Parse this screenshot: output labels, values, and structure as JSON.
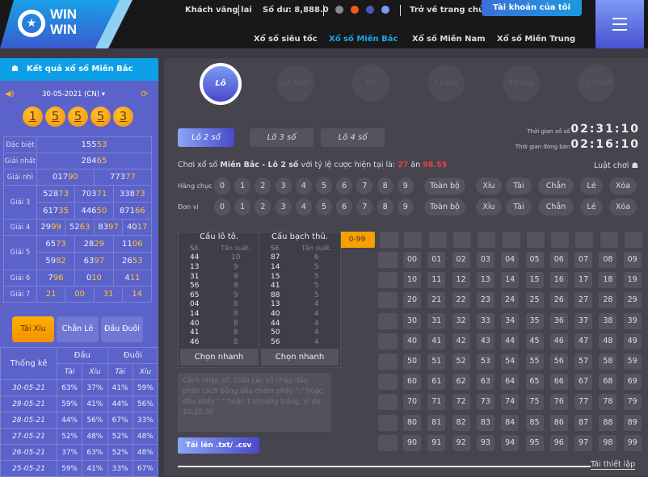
{
  "brand": {
    "logo_text": "WIN WIN"
  },
  "header": {
    "user": "Khách vãng lai",
    "balance": "Số dư: 8,888.0",
    "home": "Trở về trang chủ",
    "account": "Tài khoản của tôi",
    "nav": [
      "Xổ số siêu tốc",
      "Xổ số Miền Bắc",
      "Xổ số Miền Nam",
      "Xổ số Miền Trung"
    ],
    "active_nav": 1,
    "dot_colors": [
      "#888888",
      "#f05a1a",
      "#4a57c0",
      "#7b9af5"
    ]
  },
  "results": {
    "title": "Kết quả xổ số Miền Bắc",
    "date": "30-05-2021 (CN)",
    "balls": [
      "1",
      "5",
      "5",
      "5",
      "3"
    ],
    "prizes": [
      {
        "label": "Đặc biệt",
        "rows": [
          [
            "15553"
          ]
        ]
      },
      {
        "label": "Giải nhất",
        "rows": [
          [
            "28465"
          ]
        ]
      },
      {
        "label": "Giải nhì",
        "rows": [
          [
            "01790",
            "77377"
          ]
        ]
      },
      {
        "label": "Giải 3",
        "rows": [
          [
            "52873",
            "70371",
            "33873"
          ],
          [
            "61735",
            "44650",
            "87166"
          ]
        ]
      },
      {
        "label": "Giải 4",
        "rows": [
          [
            "2999",
            "5263",
            "8397",
            "4017"
          ]
        ]
      },
      {
        "label": "Giải 5",
        "rows": [
          [
            "6573",
            "2829",
            "1106"
          ],
          [
            "5982",
            "6397",
            "2653"
          ]
        ]
      },
      {
        "label": "Giải 6",
        "rows": [
          [
            "796",
            "010",
            "411"
          ]
        ]
      },
      {
        "label": "Giải 7",
        "rows": [
          [
            "21",
            "00",
            "31",
            "14"
          ]
        ]
      }
    ]
  },
  "stats": {
    "tabs": [
      "Tài Xỉu",
      "Chẵn Lẻ",
      "Đầu Đuôi"
    ],
    "active_tab": 0,
    "header": "Thống kê",
    "groups": [
      "Đầu",
      "Đuôi"
    ],
    "sub": [
      "Tài",
      "Xỉu",
      "Tài",
      "Xỉu"
    ],
    "rows": [
      [
        "30-05-21",
        "63%",
        "37%",
        "41%",
        "59%"
      ],
      [
        "29-05-21",
        "59%",
        "41%",
        "44%",
        "56%"
      ],
      [
        "28-05-21",
        "44%",
        "56%",
        "67%",
        "33%"
      ],
      [
        "27-05-21",
        "52%",
        "48%",
        "52%",
        "48%"
      ],
      [
        "26-05-21",
        "37%",
        "63%",
        "52%",
        "48%"
      ],
      [
        "25-05-21",
        "59%",
        "41%",
        "33%",
        "67%"
      ]
    ]
  },
  "games": [
    "Lô",
    "Lô Xiên",
    "Đề",
    "3 Càng",
    "4 Càng",
    "Lô Trượt"
  ],
  "active_game": 0,
  "subtabs": [
    "Lô 2 số",
    "Lô 3 số",
    "Lô 4 số"
  ],
  "active_subtab": 0,
  "timers": {
    "draw_label": "Thời gian xổ số :",
    "draw": "02:31:10",
    "close_label": "Thời gian đóng bàn :",
    "close": "02:16:10"
  },
  "info": {
    "prefix": "Chơi xổ số ",
    "region": "Miền Bắc - Lô 2 số",
    "mid": " với tỷ lệ cược hiện tại là: ",
    "odds_a": "27",
    "an": " ăn ",
    "odds_b": "98.55",
    "rules": "Luật chơi"
  },
  "pickers": {
    "rows": [
      "Hàng chục",
      "Đơn vị"
    ],
    "digits": [
      "0",
      "1",
      "2",
      "3",
      "4",
      "5",
      "6",
      "7",
      "8",
      "9"
    ],
    "quick": [
      "Toàn bộ",
      "Xỉu",
      "Tài",
      "Chẵn",
      "Lẻ",
      "Xóa"
    ]
  },
  "cau": [
    {
      "title": "Cầu lô tô.",
      "cols": [
        "Số.",
        "Tần suất."
      ],
      "rows": [
        [
          "44",
          "10"
        ],
        [
          "13",
          "9"
        ],
        [
          "31",
          "9"
        ],
        [
          "56",
          "9"
        ],
        [
          "65",
          "9"
        ],
        [
          "04",
          "8"
        ],
        [
          "14",
          "8"
        ],
        [
          "40",
          "8"
        ],
        [
          "41",
          "8"
        ],
        [
          "46",
          "8"
        ]
      ],
      "button": "Chọn nhanh"
    },
    {
      "title": "Cầu bạch thủ.",
      "cols": [
        "Số.",
        "Tần suất."
      ],
      "rows": [
        [
          "87",
          "6"
        ],
        [
          "14",
          "5"
        ],
        [
          "15",
          "5"
        ],
        [
          "41",
          "5"
        ],
        [
          "88",
          "5"
        ],
        [
          "13",
          "4"
        ],
        [
          "40",
          "4"
        ],
        [
          "44",
          "4"
        ],
        [
          "50",
          "4"
        ],
        [
          "56",
          "4"
        ]
      ],
      "button": "Chọn nhanh"
    }
  ],
  "input": {
    "placeholder": "Cách nhập số: Giữa các số nhập dấu phân cách bằng dấu chấm phẩy \";\" hoặc dấu phẩy \",\" hoặc 1 khoảng trắng, ví dụ: 10;20;30",
    "upload": "Tải lên .txt/ .csv"
  },
  "grid": {
    "range": "0-99"
  },
  "reset": "Tái thiết lập"
}
